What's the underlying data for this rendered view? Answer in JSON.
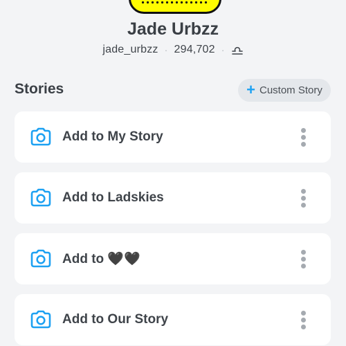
{
  "profile": {
    "display_name": "Jade Urbzz",
    "username": "jade_urbzz",
    "score": "294,702",
    "separator": "·",
    "zodiac_icon": "libra-icon",
    "snapcode_color": "#fffc00"
  },
  "stories": {
    "title": "Stories",
    "custom_story_label": "Custom Story",
    "add_icon": "plus-icon",
    "items": [
      {
        "label": "Add to My Story",
        "icon": "camera-icon"
      },
      {
        "label": "Add to Ladskies",
        "icon": "camera-icon"
      },
      {
        "label": "Add to 🖤🖤",
        "icon": "camera-icon"
      },
      {
        "label": "Add to Our Story",
        "icon": "camera-icon"
      }
    ]
  },
  "colors": {
    "accent": "#1da1f2",
    "background": "#f3f4f6",
    "card": "#ffffff"
  }
}
